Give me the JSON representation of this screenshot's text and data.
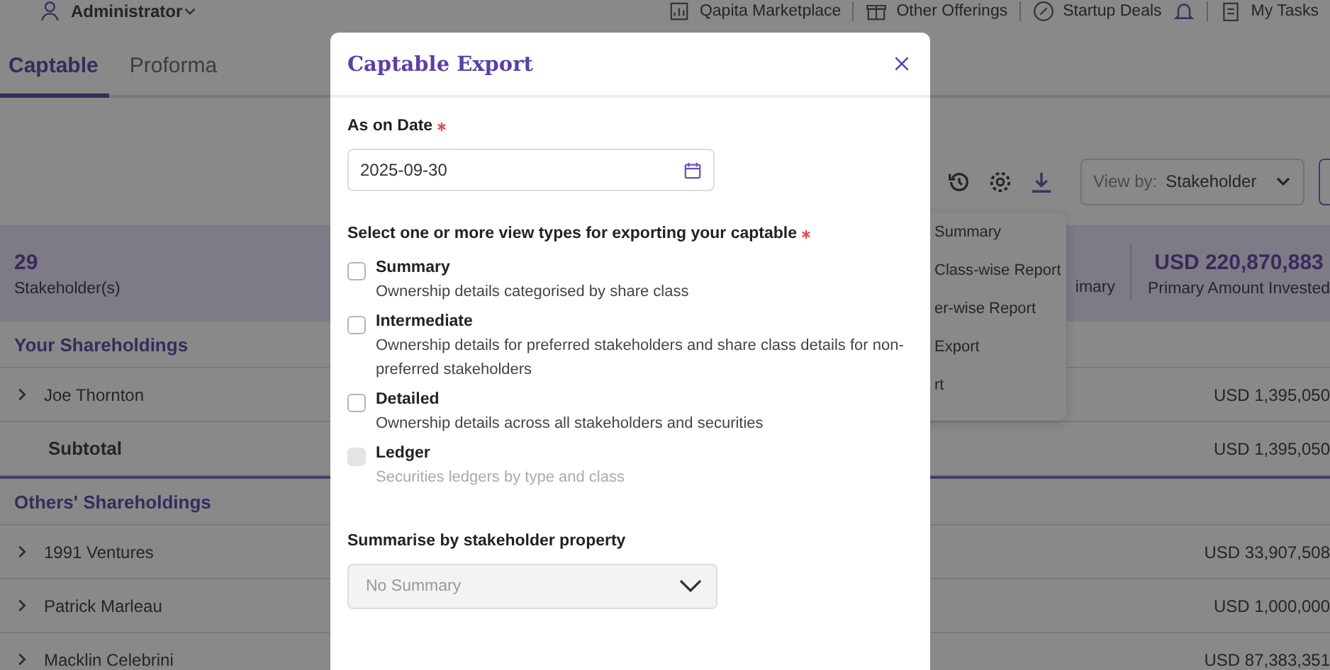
{
  "header": {
    "user": "Administrator",
    "links": [
      {
        "label": "Qapita Marketplace"
      },
      {
        "label": "Other Offerings"
      },
      {
        "label": "Startup Deals"
      },
      {
        "label": "My Tasks"
      }
    ]
  },
  "tabs": [
    {
      "label": "Captable",
      "selected": true
    },
    {
      "label": "Proforma",
      "selected": false
    }
  ],
  "toolbar": {
    "view_by_label": "View by:",
    "view_by_value": "Stakeholder"
  },
  "export_menu": [
    "Summary",
    "Class-wise Report",
    "er-wise Report",
    "Export",
    "rt"
  ],
  "summary": {
    "count": "29",
    "count_label": "Stakeholder(s)",
    "fragment": "imary",
    "amount": "USD 220,870,883",
    "amount_label": "Primary Amount Invested"
  },
  "sections": [
    {
      "title": "Your Shareholdings",
      "rows": [
        {
          "kind": "expandable",
          "name": "Joe Thornton",
          "amount": "USD 1,395,050"
        },
        {
          "kind": "subtotal",
          "name": "Subtotal",
          "amount": "USD 1,395,050"
        }
      ]
    },
    {
      "title": "Others' Shareholdings",
      "rows": [
        {
          "kind": "expandable",
          "name": "1991 Ventures",
          "amount": "USD 33,907,508"
        },
        {
          "kind": "expandable",
          "name": "Patrick Marleau",
          "amount": "USD 1,000,000"
        },
        {
          "kind": "expandable",
          "name": "Macklin Celebrini",
          "amount": "USD 87,383,351"
        }
      ]
    }
  ],
  "modal": {
    "title": "Captable Export",
    "date_label": "As on Date",
    "date_required": true,
    "date_value": "2025-09-30",
    "instruction": "Select one or more view types for exporting your captable",
    "instruction_required": true,
    "options": [
      {
        "label": "Summary",
        "description": "Ownership details categorised by share class",
        "checked": false,
        "disabled": false
      },
      {
        "label": "Intermediate",
        "description": "Ownership details for preferred stakeholders and share class details for non-preferred stakeholders",
        "checked": false,
        "disabled": false
      },
      {
        "label": "Detailed",
        "description": "Ownership details across all stakeholders and securities",
        "checked": false,
        "disabled": false
      },
      {
        "label": "Ledger",
        "description": "Securities ledgers by type and class",
        "checked": false,
        "disabled": true
      }
    ],
    "summarise_label": "Summarise by stakeholder property",
    "summarise_value": "No Summary"
  }
}
